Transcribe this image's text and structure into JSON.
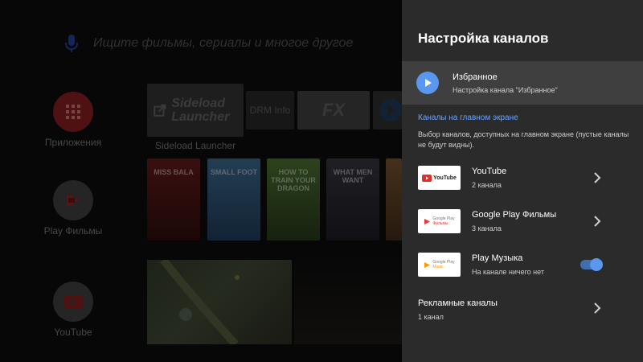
{
  "launcher": {
    "search_placeholder": "Ищите фильмы, сериалы и многое другое",
    "apps": [
      {
        "label": "Приложения"
      },
      {
        "label": "Play Фильмы"
      },
      {
        "label": "YouTube"
      }
    ],
    "sideload_tile_text": "Sideload Launcher",
    "sideload_caption": "Sideload Launcher",
    "drm_tile_text": "DRM Info",
    "fx_tile_text": "FX",
    "posters": [
      {
        "title": "MISS BALA",
        "color": "#6b1d1d"
      },
      {
        "title": "SMALL FOOT",
        "color": "#3c6a8f"
      },
      {
        "title": "HOW TO TRAIN YOUR DRAGON",
        "color": "#3d5b2a"
      },
      {
        "title": "WHAT MEN WANT",
        "color": "#2a2a30"
      },
      {
        "title": "",
        "color": "#6a4a2a"
      }
    ]
  },
  "panel": {
    "title": "Настройка каналов",
    "favorites": {
      "title": "Избранное",
      "subtitle": "Настройка канала \"Избранное\""
    },
    "section_heading": "Каналы на главном экране",
    "section_description": "Выбор каналов, доступных на главном экране (пустые каналы не будут видны).",
    "channels": [
      {
        "name": "YouTube",
        "sub": "2 канала",
        "logo": "youtube-logo",
        "logo_text": "YouTube",
        "control": "chevron"
      },
      {
        "name": "Google Play Фильмы",
        "sub": "3 канала",
        "logo": "google-play-movies-logo",
        "logo_line1": "Google Play",
        "logo_line2": "Фильмы",
        "control": "chevron"
      },
      {
        "name": "Play Музыка",
        "sub": "На канале ничего нет",
        "logo": "google-play-music-logo",
        "logo_line1": "Google Play",
        "logo_line2": "Music",
        "control": "toggle",
        "enabled": true
      }
    ],
    "ads": {
      "name": "Рекламные каналы",
      "sub": "1 канал"
    }
  },
  "colors": {
    "accent": "#5a97ef",
    "panel_bg": "#2b2b2b",
    "selected_row_bg": "#3f3f3f",
    "section_heading": "#6aa3ff"
  }
}
